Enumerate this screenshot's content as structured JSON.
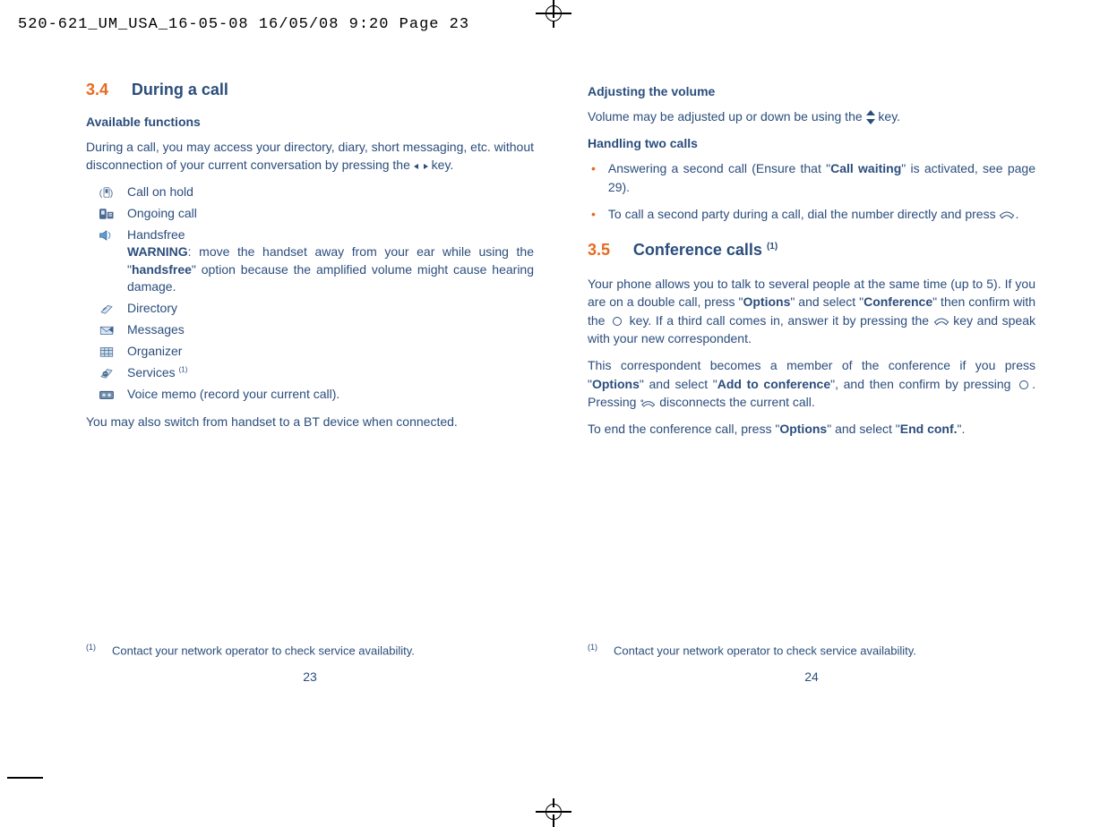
{
  "header": "520-621_UM_USA_16-05-08  16/05/08  9:20  Page 23",
  "left": {
    "sec_num": "3.4",
    "sec_title": "During a call",
    "sub1": "Available functions",
    "intro_a": "During a call, you may access your directory, diary, short messaging, etc. without disconnection of your current conversation by pressing the ",
    "intro_b": " key.",
    "funcs": {
      "f0": "Call on hold",
      "f1": "Ongoing call",
      "f2a": "Handsfree",
      "f2b1": "WARNING",
      "f2b2": ": move the handset away from your ear while using the \"",
      "f2b3": "handsfree",
      "f2b4": "\" option because the amplified volume might cause hearing damage.",
      "f3": "Directory",
      "f4": "Messages",
      "f5": "Organizer",
      "f6a": "Services ",
      "f6sup": "(1)",
      "f7": "Voice memo (record your current call)."
    },
    "bt_line": "You may also switch from handset to a BT device when connected.",
    "footnote_mark": "(1)",
    "footnote_text": "Contact your network operator to check service availability.",
    "pagenum": "23"
  },
  "right": {
    "sub1": "Adjusting the volume",
    "vol_a": "Volume may be adjusted up or down be using the ",
    "vol_b": " key.",
    "sub2": "Handling two calls",
    "b1a": "Answering a second call (Ensure that \"",
    "b1b": "Call waiting",
    "b1c": "\" is activated, see page 29).",
    "b2a": "To call a second party during a call, dial the number directly and press ",
    "b2b": ".",
    "sec_num": "3.5",
    "sec_title": "Conference calls ",
    "sec_sup": "(1)",
    "p1a": "Your phone allows you to talk to several people at the same time (up to 5). If you are on a double call, press \"",
    "p1b": "Options",
    "p1c": "\" and select \"",
    "p1d": "Conference",
    "p1e": "\" then confirm with the ",
    "p1f": " key. If a third call comes in, answer it by pressing the ",
    "p1g": " key and speak with your new correspondent.",
    "p2a": "This correspondent becomes a member of the conference if you press \"",
    "p2b": "Options",
    "p2c": "\" and select \"",
    "p2d": "Add to conference",
    "p2e": "\", and then confirm by pressing ",
    "p2f": ". Pressing ",
    "p2g": " disconnects the current call.",
    "p3a": "To end the conference call, press \"",
    "p3b": "Options",
    "p3c": "\" and select \"",
    "p3d": "End conf.",
    "p3e": "\".",
    "footnote_mark": "(1)",
    "footnote_text": "Contact your network operator to check service availability.",
    "pagenum": "24"
  }
}
